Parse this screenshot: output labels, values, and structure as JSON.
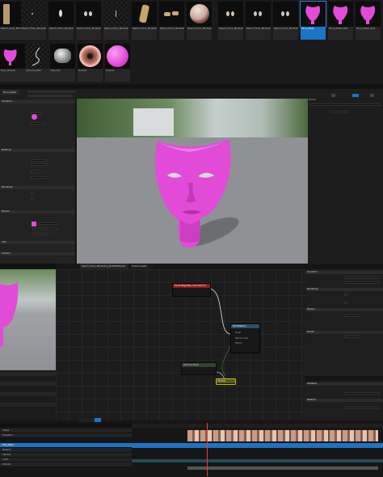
{
  "browser": {
    "tiles": [
      {
        "label": "Peach_Face_Modeling_Result"
      },
      {
        "label": "Peach_Face_Modeling_Result_Nonsense"
      },
      {
        "label": "Peach_Face_Modeling_Eyes"
      },
      {
        "label": "Peach_Face_Modeling_Eye_L"
      },
      {
        "label": "Peach_Face_Modeling_Eye_R"
      },
      {
        "label": "Peach_Face_Modeling_Skull"
      },
      {
        "label": "Peach_Face_Modeling_Teeth"
      },
      {
        "label": "Peach_Face_Modeling_Head"
      },
      {
        "label": "Peach_Face_Modeling_Eyes_Blue"
      },
      {
        "label": "Peach_Face_Modeling_Eyes_Brown"
      },
      {
        "label": "Peach_Face_Modeling_Eyes_Green"
      },
      {
        "label": "Face_Mask"
      },
      {
        "label": "Face_Mask_Mat"
      },
      {
        "label": "Face_Mask_Inst"
      },
      {
        "label": "Hair_Strand"
      },
      {
        "label": "Chrome_Ball"
      },
      {
        "label": "Eye_Iris"
      },
      {
        "label": "M_Pink"
      }
    ],
    "selected_label": "Face_Mask"
  },
  "colors": {
    "accent": "#1d74c7",
    "mask": "#e24bd8",
    "node_red": "#8e1c1c",
    "node_blue": "#2c5170",
    "node_yellow": "#c7b81d"
  },
  "tabs": {
    "viewport_tab": "Face_Mask",
    "graph_tab": "Peach_Face_Modeling_BuildMaterial",
    "graph_sub": "Event Graph"
  },
  "details": {
    "sections": [
      "Transform",
      "Materials",
      "Rendering",
      "Physics",
      "LOD",
      "Collision"
    ]
  },
  "graph": {
    "event_node": "Event BeginPlay (reconstruct)",
    "set_node": "Set Material",
    "set_pins": [
      "Target",
      "Material Index",
      "Material"
    ],
    "get_node": "Get Face Mask",
    "pink_node": "M_Pink"
  },
  "right_panel": {
    "title": "Details",
    "items": [
      "Transform",
      "Rendering",
      "Physics",
      "Events",
      "Variables",
      "Material"
    ]
  },
  "timeline": {
    "tracks": [
      "Tracks",
      "Face_Mask",
      "Transform",
      "Material",
      "Camera",
      "Audio",
      "Director"
    ],
    "selected_track": "Face_Mask"
  }
}
